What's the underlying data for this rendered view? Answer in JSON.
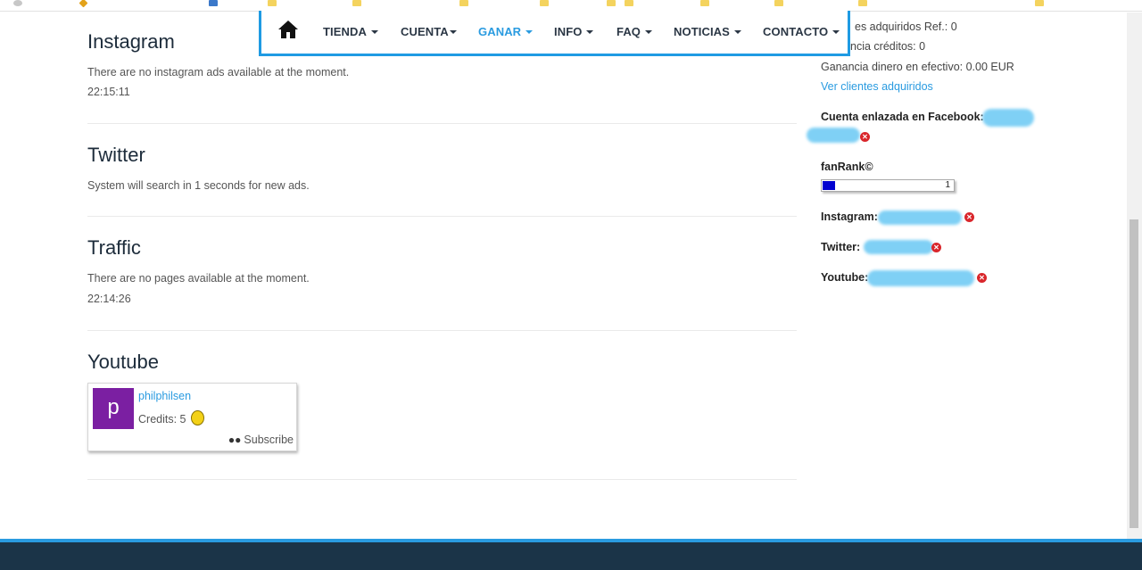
{
  "nav": {
    "items": [
      {
        "label": "TIENDA",
        "active": false
      },
      {
        "label": "CUENTA",
        "active": false
      },
      {
        "label": "GANAR",
        "active": true
      },
      {
        "label": "INFO",
        "active": false
      },
      {
        "label": "FAQ",
        "active": false
      },
      {
        "label": "NOTICIAS",
        "active": false
      },
      {
        "label": "CONTACTO",
        "active": false
      }
    ]
  },
  "sections": {
    "instagram": {
      "title": "Instagram",
      "message": "There are no instagram ads available at the moment.",
      "time": "22:15:11"
    },
    "twitter": {
      "title": "Twitter",
      "message": "System will search in 1 seconds for new ads."
    },
    "traffic": {
      "title": "Traffic",
      "message": "There are no pages available at the moment.",
      "time": "22:14:26"
    },
    "youtube": {
      "title": "Youtube",
      "card": {
        "avatar_letter": "p",
        "username": "philphilsen",
        "credits": "Credits: 5",
        "subscribe_label": "Subscribe"
      }
    }
  },
  "sidebar": {
    "clients_ref": "es adquiridos Ref.: 0",
    "credits_gain": "ncia créditos: 0",
    "cash_gain": "Ganancia dinero en efectivo: 0.00 EUR",
    "clients_link": "Ver clientes adquiridos",
    "facebook_label": "Cuenta enlazada en Facebook:",
    "fanrank_label": "fanRank©",
    "fanrank_value": "1",
    "instagram_label": "Instagram:",
    "twitter_label": "Twitter:",
    "youtube_label": "Youtube:"
  },
  "colors": {
    "accent": "#2a9be0",
    "footer": "#1b3448",
    "avatar": "#7b1fa2",
    "rank_fill": "#0000d0"
  }
}
